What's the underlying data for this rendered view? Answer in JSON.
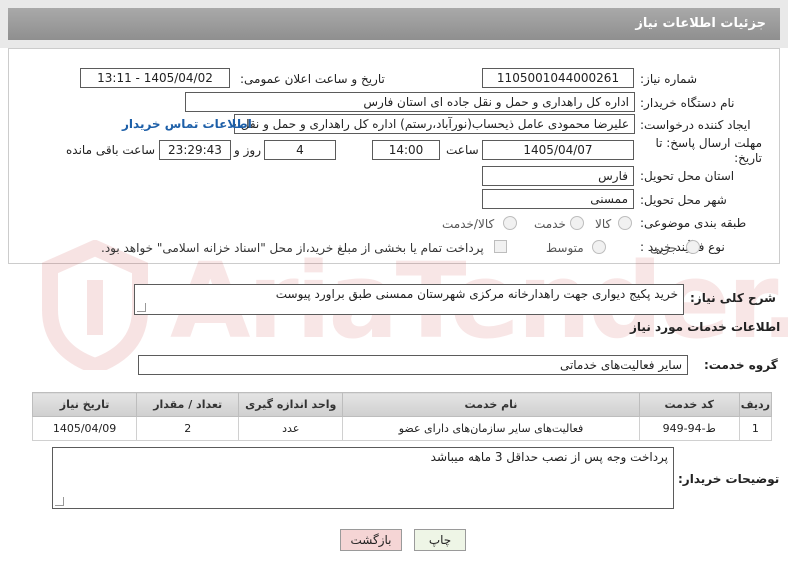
{
  "header": {
    "title": "جزئیات اطلاعات نیاز"
  },
  "fields": {
    "need_number_label": "شماره نیاز:",
    "need_number": "1105001044000261",
    "announce_label": "تاریخ و ساعت اعلان عمومی:",
    "announce_value": "1405/04/02 - 13:11",
    "buyer_org_label": "نام دستگاه خریدار:",
    "buyer_org": "اداره کل راهداری و حمل و نقل جاده ای استان فارس",
    "creator_label": "ایجاد کننده درخواست:",
    "creator": "علیرضا محمودی عامل ذیحساب(نورآباد،رستم) اداره کل راهداری و حمل و نقل جا",
    "contact_link": "اطلاعات تماس خریدار",
    "deadline_label": "مهلت ارسال پاسخ: تا تاریخ:",
    "deadline_date": "1405/04/07",
    "time_label": "ساعت",
    "deadline_time": "14:00",
    "days_value": "4",
    "days_label": "روز و",
    "remaining_time": "23:29:43",
    "remaining_label": "ساعت باقی مانده",
    "province_label": "استان محل تحویل:",
    "province": "فارس",
    "city_label": "شهر محل تحویل:",
    "city": "ممسنی",
    "category_label": "طبقه بندی موضوعی:",
    "category_options": [
      "کالا",
      "خدمت",
      "کالا/خدمت"
    ],
    "process_label": "نوع فرآیند خرید :",
    "process_options": [
      "جزیی",
      "متوسط"
    ],
    "payment_note": "پرداخت تمام یا بخشی از مبلغ خرید،از محل \"اسناد خزانه اسلامی\" خواهد بود."
  },
  "summary": {
    "label": "شرح کلی نیاز:",
    "value": "خرید پکیج دیواری جهت راهدارخانه مرکزی شهرستان ممسنی طبق براورد پیوست"
  },
  "services_info": {
    "title": "اطلاعات خدمات مورد نیاز"
  },
  "service_group": {
    "label": "گروه خدمت:",
    "value": "سایر فعالیت‌های خدماتی"
  },
  "table": {
    "headers": [
      "ردیف",
      "کد خدمت",
      "نام خدمت",
      "واحد اندازه گیری",
      "تعداد / مقدار",
      "تاریخ نیاز"
    ],
    "rows": [
      [
        "1",
        "ط-94-949",
        "فعالیت‌های سایر سازمان‌های دارای عضو",
        "عدد",
        "2",
        "1405/04/09"
      ]
    ]
  },
  "buyer_notes": {
    "label": "توضیحات خریدار:",
    "value": "پرداخت وجه پس از نصب حداقل 3 ماهه میباشد"
  },
  "buttons": {
    "print": "چاپ",
    "back": "بازگشت"
  },
  "watermark": {
    "text": "AriaTender.net"
  },
  "colors": {
    "header_bar": "#999999",
    "link": "#1d5fa8",
    "back_button": "#f5d5d5",
    "print_button": "#eef5e6"
  }
}
